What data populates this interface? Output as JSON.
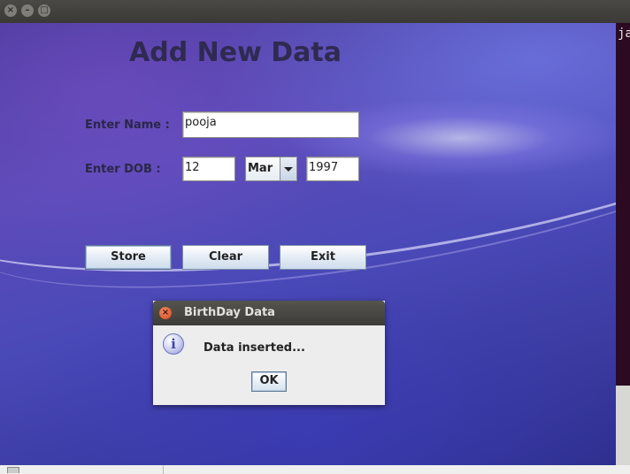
{
  "window": {
    "controls": [
      "close",
      "minimize",
      "maximize"
    ]
  },
  "form": {
    "heading": "Add New Data",
    "name_label": "Enter Name :",
    "name_value": "pooja",
    "dob_label": "Enter DOB :",
    "dob_day": "12",
    "dob_month": "Mar",
    "dob_year": "1997"
  },
  "buttons": {
    "store": "Store",
    "clear": "Clear",
    "exit": "Exit"
  },
  "dialog": {
    "title": "BirthDay Data",
    "message": "Data inserted...",
    "ok": "OK",
    "icon": "info-icon"
  },
  "background": {
    "terminal_text": "ja"
  },
  "colors": {
    "title_bar": "#3d3c38",
    "button_face": "#e7eef6",
    "dialog_close": "#d4471a"
  }
}
